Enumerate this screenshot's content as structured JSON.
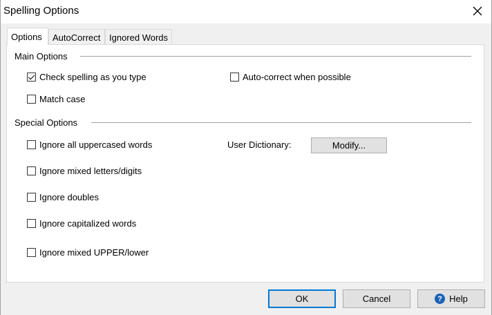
{
  "window": {
    "title": "Spelling Options",
    "close_icon": "close-icon"
  },
  "tabs": [
    {
      "label": "Options",
      "active": true
    },
    {
      "label": "AutoCorrect",
      "active": false
    },
    {
      "label": "Ignored Words",
      "active": false
    }
  ],
  "main_options": {
    "label": "Main Options",
    "check_spelling": {
      "label": "Check spelling as you type",
      "checked": true
    },
    "auto_correct": {
      "label": "Auto-correct when possible",
      "checked": false
    },
    "match_case": {
      "label": "Match case",
      "checked": false
    }
  },
  "special_options": {
    "label": "Special Options",
    "ignore_uppercased": {
      "label": "Ignore all uppercased words",
      "checked": false
    },
    "ignore_mixed_digits": {
      "label": "Ignore mixed letters/digits",
      "checked": false
    },
    "ignore_doubles": {
      "label": "Ignore doubles",
      "checked": false
    },
    "ignore_capitalized": {
      "label": "Ignore capitalized words",
      "checked": false
    },
    "ignore_mixed_case": {
      "label": "Ignore mixed UPPER/lower",
      "checked": false
    },
    "user_dictionary_label": "User Dictionary:",
    "modify_label": "Modify..."
  },
  "buttons": {
    "ok": "OK",
    "cancel": "Cancel",
    "help": "Help",
    "help_icon": "help-icon"
  },
  "colors": {
    "accent": "#0078d7",
    "help_icon_bg": "#1a62b7"
  }
}
